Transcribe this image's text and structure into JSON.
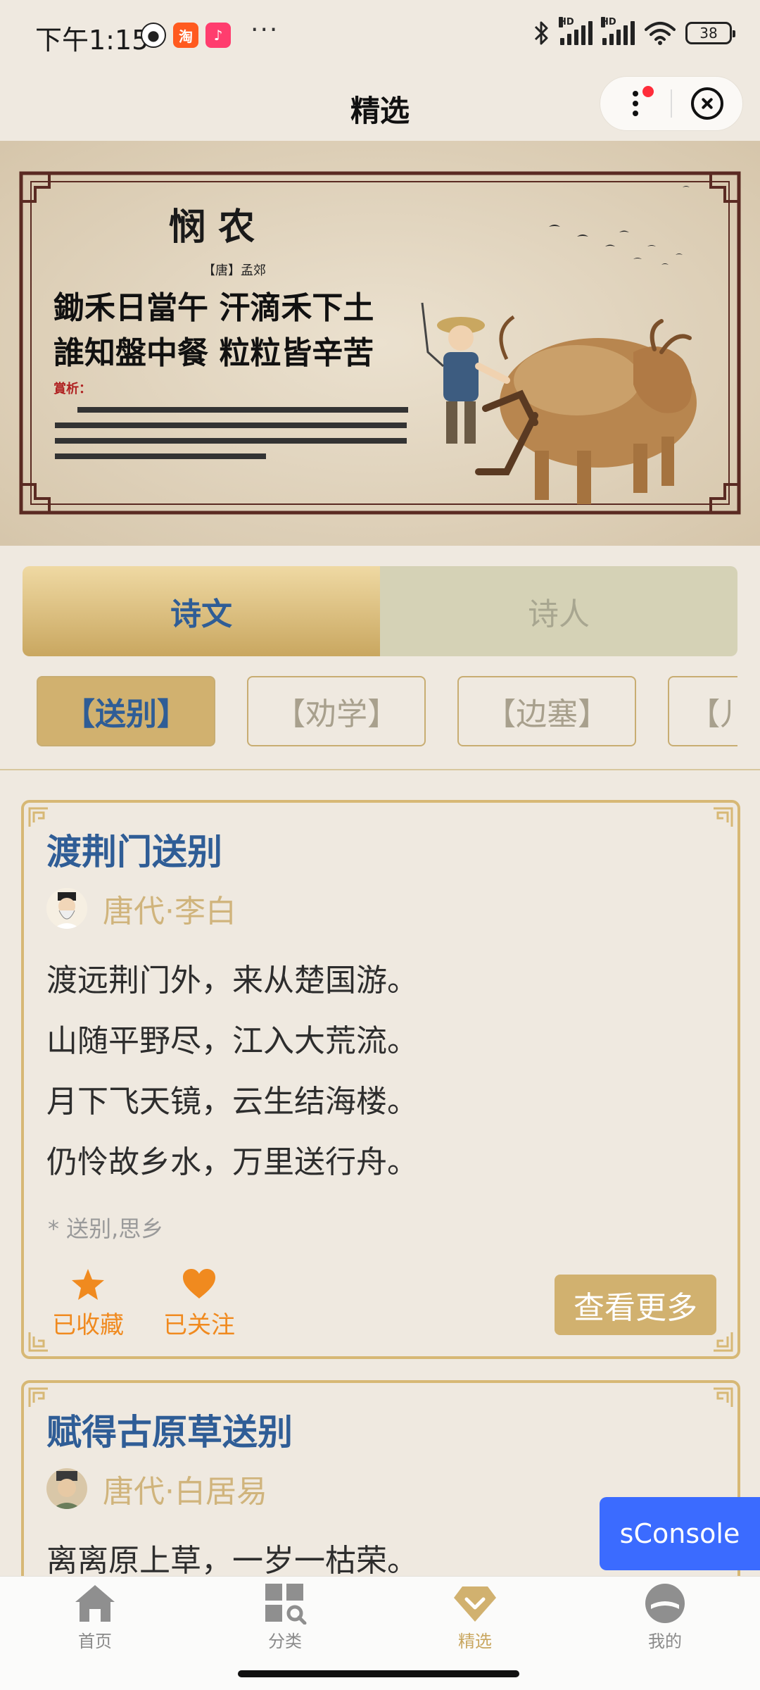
{
  "status": {
    "time": "下午1:15",
    "app_icons": [
      "panda-icon",
      "taobao-icon",
      "music-icon"
    ],
    "dots": "···",
    "battery": "38"
  },
  "header": {
    "title": "精选"
  },
  "banner": {
    "poem_title": "悯 农",
    "dynasty_author": "【唐】孟郊",
    "line1": "鋤禾日當午 汗滴禾下土",
    "line2": "誰知盤中餐 粒粒皆辛苦",
    "note_label": "賞析："
  },
  "tabs": [
    {
      "label": "诗文",
      "active": true
    },
    {
      "label": "诗人",
      "active": false
    }
  ],
  "categories": [
    {
      "label": "【送别】",
      "active": true
    },
    {
      "label": "【劝学】",
      "active": false
    },
    {
      "label": "【边塞】",
      "active": false
    },
    {
      "label": "【儿",
      "active": false
    }
  ],
  "poems": [
    {
      "title": "渡荆门送别",
      "author": "唐代·李白",
      "lines": [
        "渡远荆门外，来从楚国游。",
        "山随平野尽，江入大荒流。",
        "月下飞天镜，云生结海楼。",
        "仍怜故乡水，万里送行舟。"
      ],
      "tags": "* 送别,思乡",
      "collect_label": "已收藏",
      "follow_label": "已关注",
      "more_label": "查看更多"
    },
    {
      "title": "赋得古原草送别",
      "author": "唐代·白居易",
      "lines": [
        "离离原上草，一岁一枯荣。"
      ]
    }
  ],
  "sconsole": "sConsole",
  "tabbar": [
    {
      "label": "首页",
      "icon": "home-icon",
      "active": false
    },
    {
      "label": "分类",
      "icon": "category-search-icon",
      "active": false
    },
    {
      "label": "精选",
      "icon": "featured-gem-icon",
      "active": true
    },
    {
      "label": "我的",
      "icon": "profile-icon",
      "active": false
    }
  ],
  "colors": {
    "background": "#efe9e0",
    "accent_gold": "#c9a760",
    "title_blue": "#2f5d96",
    "action_orange": "#f08a1f",
    "sconsole_blue": "#3b6bff"
  }
}
